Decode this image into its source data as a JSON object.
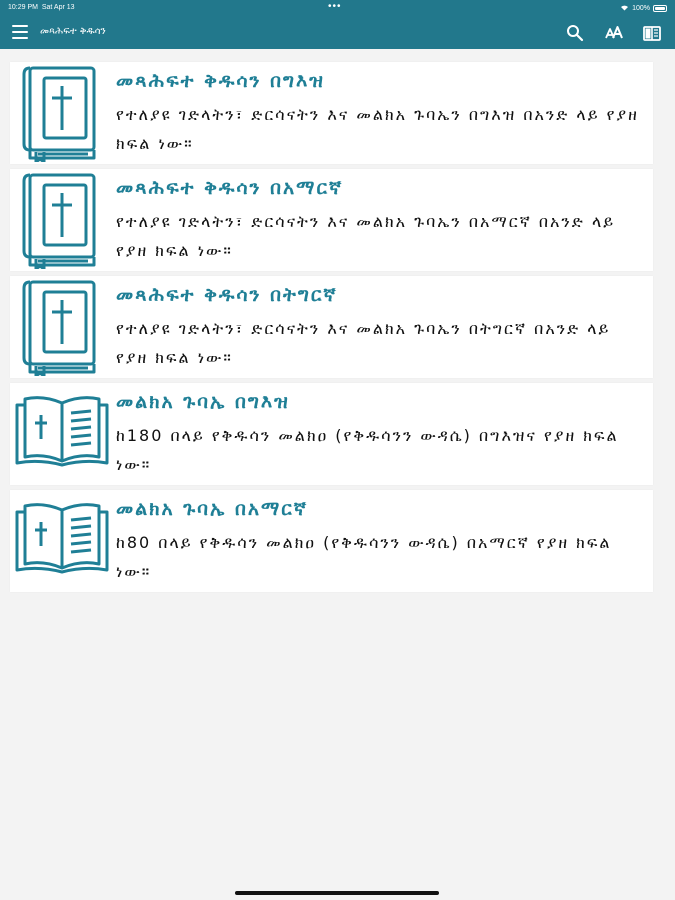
{
  "status_bar": {
    "time": "10:29 PM",
    "date": "Sat Apr 13",
    "battery": "100%",
    "dots": "•••"
  },
  "header": {
    "title": "መጻሕፍተ ቅዱሳን",
    "icons": [
      "menu-icon",
      "search-icon",
      "font-size-icon",
      "book-icon"
    ]
  },
  "theme": {
    "accent": "#22788c",
    "title_color": "#1f7f96",
    "background": "#f3f3f3"
  },
  "items": [
    {
      "icon": "closed-bible-icon",
      "title": "መጻሕፍተ ቅዱሳን በግእዝ",
      "description": "የተለያዩ ገድላትን፣ ድርሳናትን እና መልክአ ጉባኤን በግእዝ በአንድ ላይ የያዘ ክፍል ነው።"
    },
    {
      "icon": "closed-bible-icon",
      "title": "መጻሕፍተ ቅዱሳን በአማርኛ",
      "description": "የተለያዩ ገድላትን፣ ድርሳናትን እና መልክአ ጉባኤን በአማርኛ በአንድ ላይ የያዘ ክፍል ነው።"
    },
    {
      "icon": "closed-bible-icon",
      "title": "መጻሕፍተ ቅዱሳን በትግርኛ",
      "description": "የተለያዩ ገድላትን፣ ድርሳናትን እና መልክአ ጉባኤን በትግርኛ በአንድ ላይ የያዘ ክፍል ነው።"
    },
    {
      "icon": "open-bible-icon",
      "title": "መልክአ ጉባኤ በግእዝ",
      "description": "ከ180 በላይ የቅዱሳን መልክዐ (የቅዱሳንን ውዳሴ) በግእዝና የያዘ ክፍል ነው።"
    },
    {
      "icon": "open-bible-icon",
      "title": "መልክአ ጉባኤ በአማርኛ",
      "description": "ከ80 በላይ የቅዱሳን መልክዐ (የቅዱሳንን ውዳሴ) በአማርኛ የያዘ ክፍል ነው።"
    }
  ]
}
